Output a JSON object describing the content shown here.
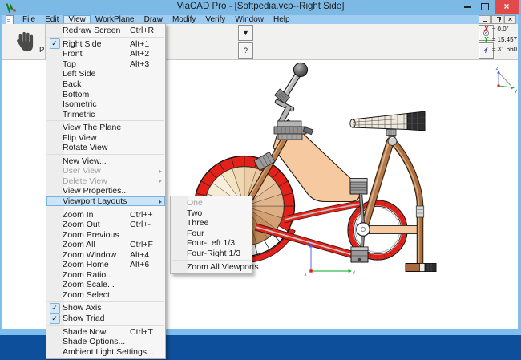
{
  "titlebar": {
    "title": "ViaCAD Pro - [Softpedia.vcp--Right Side]",
    "close_glyph": "×",
    "controls": [
      "minimize-icon",
      "maximize-icon",
      "close-icon"
    ]
  },
  "menubar": {
    "items": [
      "File",
      "Edit",
      "View",
      "WorkPlane",
      "Draw",
      "Modify",
      "Verify",
      "Window",
      "Help"
    ],
    "active": "View",
    "mdi_close_glyph": "×"
  },
  "toolbar": {
    "partial_text": "P",
    "buttons": [
      {
        "name": "filter-dropdown-button",
        "glyph": "▼"
      },
      {
        "name": "help-button",
        "glyph": "?"
      },
      {
        "name": "snap-circle-button",
        "glyph": "◎"
      },
      {
        "name": "line-tool-button",
        "glyph": "/"
      }
    ]
  },
  "coords_panel": {
    "separator": "=",
    "rows": [
      {
        "axis": "X",
        "value": "0.0\"",
        "color": "#e01010"
      },
      {
        "axis": "Y",
        "value": "15.457",
        "color": "#0f9f0f"
      },
      {
        "axis": "Z",
        "value": "31.660",
        "color": "#1540e0"
      }
    ]
  },
  "view_menu": {
    "items": [
      {
        "label": "Redraw Screen",
        "shortcut": "Ctrl+R"
      },
      {
        "separator": true
      },
      {
        "label": "Right Side",
        "shortcut": "Alt+1",
        "checked": true
      },
      {
        "label": "Front",
        "shortcut": "Alt+2"
      },
      {
        "label": "Top",
        "shortcut": "Alt+3"
      },
      {
        "label": "Left Side"
      },
      {
        "label": "Back"
      },
      {
        "label": "Bottom"
      },
      {
        "label": "Isometric"
      },
      {
        "label": "Trimetric"
      },
      {
        "separator": true
      },
      {
        "label": "View The Plane"
      },
      {
        "label": "Flip View"
      },
      {
        "label": "Rotate View"
      },
      {
        "separator": true
      },
      {
        "label": "New View..."
      },
      {
        "label": "User View",
        "disabled": true,
        "submenu_arrow": true
      },
      {
        "label": "Delete View",
        "disabled": true,
        "submenu_arrow": true
      },
      {
        "label": "View Properties..."
      },
      {
        "label": "Viewport Layouts",
        "highlighted": true,
        "submenu_arrow": true
      },
      {
        "separator": true
      },
      {
        "label": "Zoom In",
        "shortcut": "Ctrl++"
      },
      {
        "label": "Zoom Out",
        "shortcut": "Ctrl+-"
      },
      {
        "label": "Zoom Previous"
      },
      {
        "label": "Zoom All",
        "shortcut": "Ctrl+F"
      },
      {
        "label": "Zoom Window",
        "shortcut": "Alt+4"
      },
      {
        "label": "Zoom Home",
        "shortcut": "Alt+6"
      },
      {
        "label": "Zoom Ratio..."
      },
      {
        "label": "Zoom Scale..."
      },
      {
        "label": "Zoom Select"
      },
      {
        "separator": true
      },
      {
        "label": "Show Axis",
        "checked": true
      },
      {
        "label": "Show Triad",
        "checked": true
      },
      {
        "separator": true
      },
      {
        "label": "Shade Now",
        "shortcut": "Ctrl+T"
      },
      {
        "label": "Shade Options..."
      },
      {
        "label": "Ambient Light Settings..."
      }
    ]
  },
  "layouts_submenu": {
    "items": [
      {
        "label": "One",
        "disabled": true
      },
      {
        "label": "Two"
      },
      {
        "label": "Three"
      },
      {
        "label": "Four"
      },
      {
        "label": "Four-Left 1/3"
      },
      {
        "label": "Four-Right 1/3"
      },
      {
        "separator": true
      },
      {
        "label": "Zoom All Viewports"
      }
    ]
  },
  "colors": {
    "titlebar_blue": "#7cb9e5",
    "menubar_blue": "#9fccf1",
    "frame_blue": "#7dbfee",
    "desktop_blue": "#0d4f9b",
    "close_red": "#e04a4a",
    "toolbar_gray": "#f1f1f0",
    "menu_bg": "#f6f6f6",
    "menu_highlight": "#cbe4f8",
    "menu_highlight_border": "#78b3dc",
    "bike_red": "#e32118",
    "frame_peach": "#f6c9a0",
    "tube_brown": "#b5794a"
  }
}
